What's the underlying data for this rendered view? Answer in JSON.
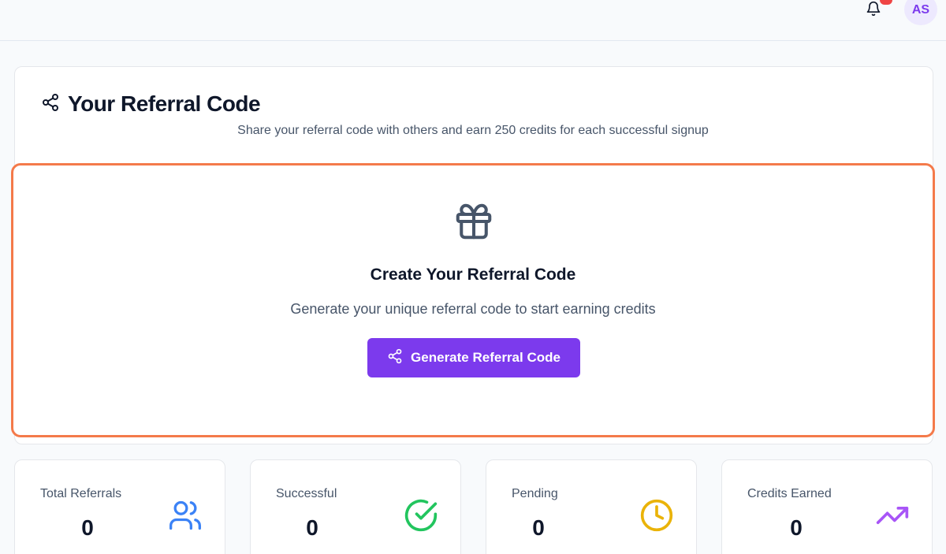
{
  "header": {
    "avatar_initials": "AS"
  },
  "referral": {
    "title": "Your Referral Code",
    "subtitle": "Share your referral code with others and earn 250 credits for each successful signup",
    "create_title": "Create Your Referral Code",
    "create_description": "Generate your unique referral code to start earning credits",
    "generate_button_label": "Generate Referral Code"
  },
  "stats": [
    {
      "label": "Total Referrals",
      "value": "0",
      "icon": "users-icon",
      "color": "#3b82f6"
    },
    {
      "label": "Successful",
      "value": "0",
      "icon": "check-circle-icon",
      "color": "#22c55e"
    },
    {
      "label": "Pending",
      "value": "0",
      "icon": "clock-icon",
      "color": "#eab308"
    },
    {
      "label": "Credits Earned",
      "value": "0",
      "icon": "trending-up-icon",
      "color": "#a855f7"
    }
  ],
  "colors": {
    "accent": "#7c3aed",
    "highlight_border": "#f47a4a",
    "notification_badge": "#ef4444"
  }
}
